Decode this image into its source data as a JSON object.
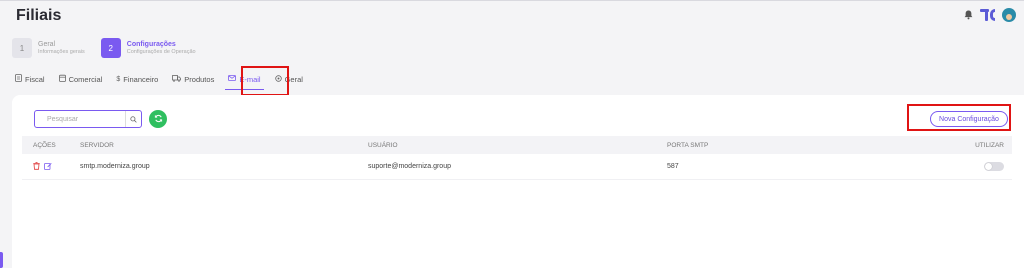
{
  "page": {
    "title": "Filiais"
  },
  "steps": [
    {
      "number": "1",
      "title": "Geral",
      "subtitle": "Informações gerais",
      "state": "inactive"
    },
    {
      "number": "2",
      "title": "Configurações",
      "subtitle": "Configurações de Operação",
      "state": "active"
    }
  ],
  "tabs": [
    {
      "label": "Fiscal",
      "icon": "document-icon"
    },
    {
      "label": "Comercial",
      "icon": "calendar-icon"
    },
    {
      "label": "Financeiro",
      "icon": "dollar-icon"
    },
    {
      "label": "Produtos",
      "icon": "truck-icon"
    },
    {
      "label": "E-mail",
      "icon": "mail-icon",
      "active": true
    },
    {
      "label": "Geral",
      "icon": "gear-icon"
    }
  ],
  "toolbar": {
    "search_placeholder": "Pesquisar",
    "new_config_label": "Nova Configuração"
  },
  "table": {
    "columns": [
      "AÇÕES",
      "SERVIDOR",
      "USUÁRIO",
      "PORTA SMTP",
      "UTILIZAR"
    ],
    "rows": [
      {
        "servidor": "smtp.moderniza.group",
        "usuario": "suporte@moderniza.group",
        "porta": "587",
        "utilizar": false
      }
    ]
  },
  "colors": {
    "accent": "#7a5af0",
    "refresh": "#2fbf60",
    "delete": "#e03c3c",
    "highlight_box": "#e01414"
  }
}
